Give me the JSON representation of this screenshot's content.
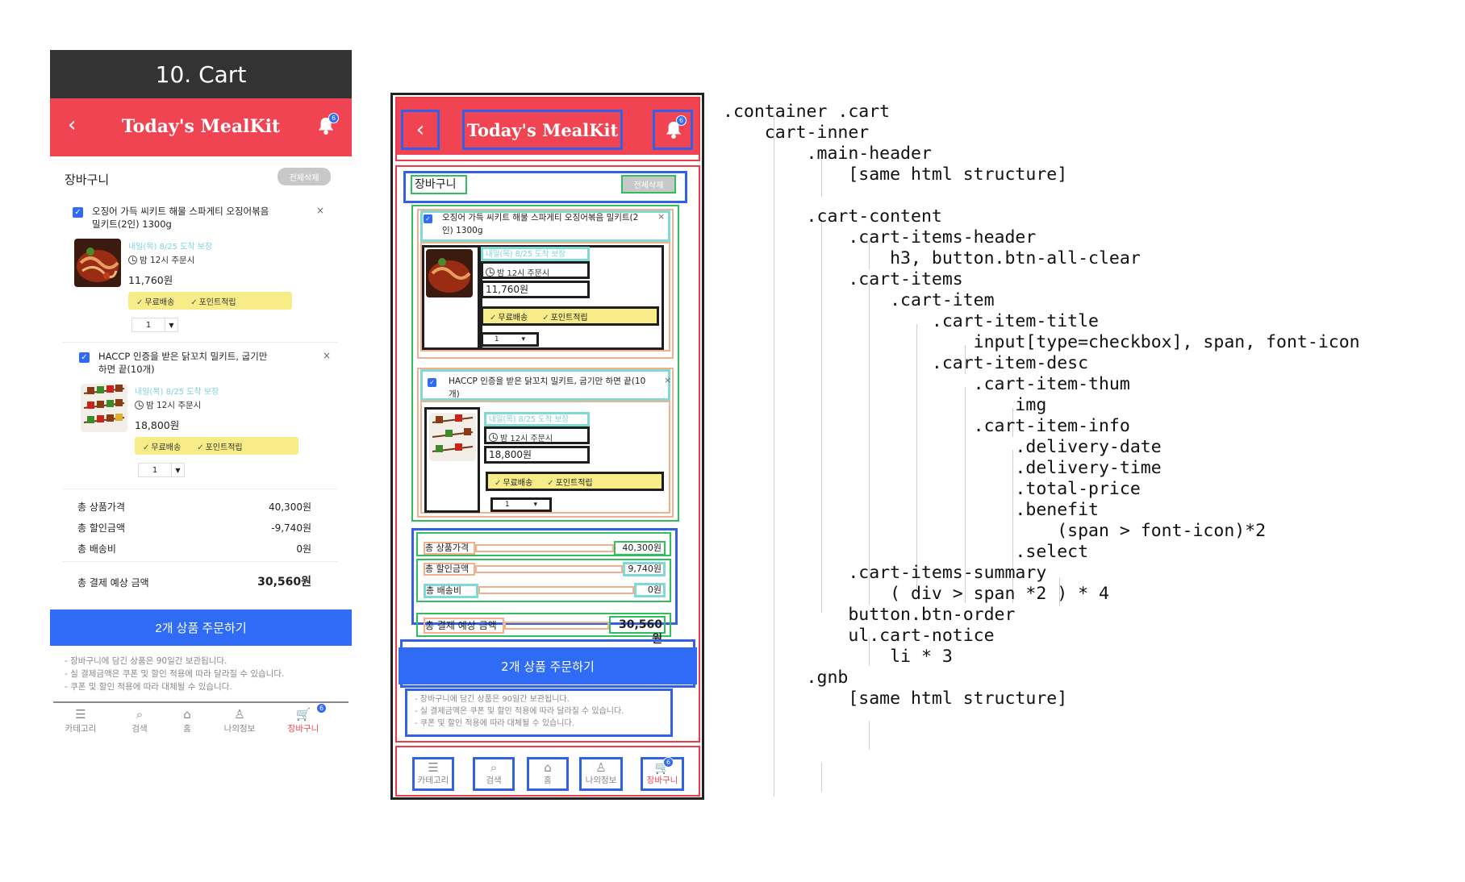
{
  "screen": {
    "title": "10. Cart",
    "header": {
      "back_icon": "chevron-left-icon",
      "brand": "Today's MealKit",
      "bell_icon": "bell-icon",
      "bell_badge": "6"
    },
    "cart": {
      "heading": "장바구니",
      "all_clear": "전체삭제",
      "items": [
        {
          "title": "오징어 가득 씨키트 해물 스파게티 오징어볶음 밀키트(2인) 1300g",
          "delivery_date": "내일(목) 8/25 도착 보장",
          "delivery_time": "밤 12시 주문시",
          "price": "11,760원",
          "benefits": [
            "무료배송",
            "포인트적립"
          ],
          "quantity": "1"
        },
        {
          "title": "HACCP 인증을 받은 닭꼬치 밀키트, 굽기만 하면 끝(10개)",
          "delivery_date": "내일(목) 8/25 도착 보장",
          "delivery_time": "밤 12시 주문시",
          "price": "18,800원",
          "benefits": [
            "무료배송",
            "포인트적립"
          ],
          "quantity": "1"
        }
      ],
      "summary": [
        {
          "label": "총 상품가격",
          "value": "40,300원"
        },
        {
          "label": "총 할인금액",
          "value": "-9,740원"
        },
        {
          "label": "총 배송비",
          "value": "0원"
        },
        {
          "label": "총 결제 예상 금액",
          "value": "30,560원"
        }
      ],
      "order_button": "2개 상품 주문하기",
      "notices": [
        "- 장바구니에 담긴 상품은 90일간 보관됩니다.",
        "- 실 결제금액은 쿠폰 및 할인 적용에 따라 달라질 수 있습니다.",
        "- 쿠폰 및 할인 적용에 따라 대체될 수 있습니다."
      ]
    },
    "gnb": [
      {
        "label": "카테고리",
        "icon": "menu-icon",
        "glyph": "☰"
      },
      {
        "label": "검색",
        "icon": "search-icon",
        "glyph": "⌕"
      },
      {
        "label": "홈",
        "icon": "home-icon",
        "glyph": "⌂"
      },
      {
        "label": "나의정보",
        "icon": "user-icon",
        "glyph": "♙"
      },
      {
        "label": "장바구니",
        "icon": "cart-icon",
        "glyph": "🛒",
        "badge": "6",
        "active": true
      }
    ]
  },
  "wireframe": {
    "summary_values": [
      "40,300원",
      "9,740원",
      "0원",
      "30,560원"
    ]
  },
  "code_tree": [
    ".container .cart",
    "    cart-inner",
    "        .main-header",
    "            [same html structure]",
    "",
    "        .cart-content",
    "            .cart-items-header",
    "                h3, button.btn-all-clear",
    "            .cart-items",
    "                .cart-item",
    "                    .cart-item-title",
    "                        input[type=checkbox], span, font-icon",
    "                    .cart-item-desc",
    "                        .cart-item-thum",
    "                            img",
    "                        .cart-item-info",
    "                            .delivery-date",
    "                            .delivery-time",
    "                            .total-price",
    "                            .benefit",
    "                                (span > font-icon)*2",
    "                            .select",
    "            .cart-items-summary",
    "                ( div > span *2 ) * 4",
    "            button.btn-order",
    "            ul.cart-notice",
    "                li * 3",
    "        .gnb",
    "            [same html structure]"
  ],
  "colors": {
    "brand_red": "#f04452",
    "order_blue": "#2f6bf5",
    "benefit_yellow": "#f7ec87",
    "date_teal": "#7dd3dc"
  }
}
